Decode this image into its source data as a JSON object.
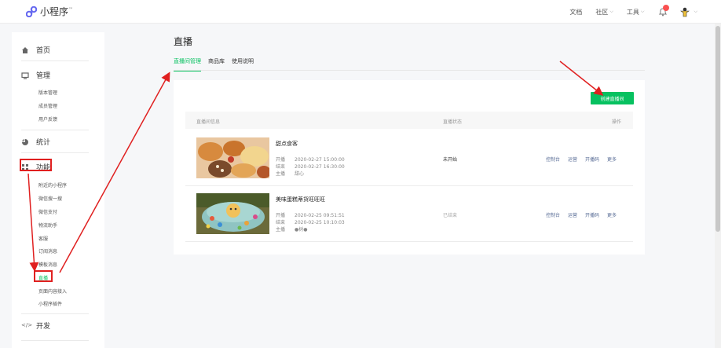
{
  "app": {
    "name": "小程序",
    "mark": "™"
  },
  "topnav": {
    "docs": "文档",
    "community": "社区",
    "tools": "工具"
  },
  "sidebar": {
    "home": "首页",
    "manage": "管理",
    "manage_items": [
      "版本管理",
      "成员管理",
      "用户反馈"
    ],
    "stats": "统计",
    "features": "功能",
    "features_items": [
      "附近的小程序",
      "微信搜一搜",
      "微信支付",
      "物流助手",
      "客服",
      "订阅消息",
      "模板消息",
      "直播",
      "页面内容接入",
      "小程序插件"
    ],
    "dev": "开发"
  },
  "main": {
    "title": "直播",
    "tabs": [
      "直播间管理",
      "商品库",
      "使用说明"
    ],
    "create_button": "创建直播间",
    "columns": {
      "info": "直播间信息",
      "status": "直播状态",
      "ops": "操作"
    },
    "rows": [
      {
        "name": "甜点食客",
        "start_label": "开播",
        "start": "2020-02-27 15:00:00",
        "end_label": "结束",
        "end": "2020-02-27 16:30:00",
        "host_label": "主播",
        "host": "甜心",
        "status": "未开始"
      },
      {
        "name": "美味蛋糕蒂货旺旺旺",
        "start_label": "开播",
        "start": "2020-02-25 09:51:51",
        "end_label": "结束",
        "end": "2020-02-25 10:10:03",
        "host_label": "主播",
        "host": "●树●",
        "status": "已结束"
      }
    ],
    "ops": [
      "控制台",
      "运营",
      "开播码",
      "更多"
    ]
  },
  "colors": {
    "accent": "#07c160",
    "link": "#576b95",
    "annotation": "#e02020"
  }
}
